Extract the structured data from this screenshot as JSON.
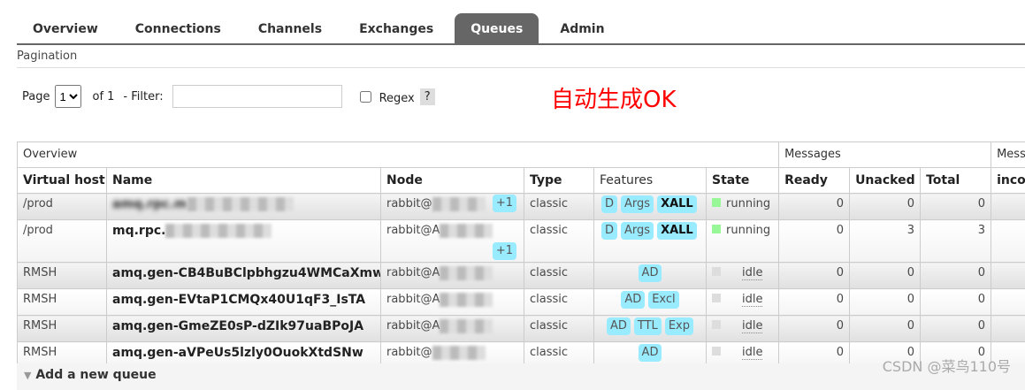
{
  "tabs": [
    "Overview",
    "Connections",
    "Channels",
    "Exchanges",
    "Queues",
    "Admin"
  ],
  "active_tab": "Queues",
  "pagination": {
    "title": "Pagination",
    "page_label": "Page",
    "page_value": "1",
    "of_label": "of 1",
    "filter_label": "- Filter:",
    "filter_value": "",
    "regex_label": "Regex",
    "help": "?"
  },
  "note": "自动生成OK",
  "table": {
    "group_overview": "Overview",
    "group_messages": "Messages",
    "group_rates": "Mess",
    "headers": [
      "Virtual host",
      "Name",
      "Node",
      "Type",
      "Features",
      "State",
      "Ready",
      "Unacked",
      "Total",
      "incon"
    ],
    "rows": [
      {
        "vhost": "/prod",
        "name": "amq.rpc.m",
        "name_blurred": true,
        "node": "rabbit@",
        "extra": "+1",
        "type": "classic",
        "features": [
          {
            "t": "D"
          },
          {
            "t": "Args"
          },
          {
            "t": "XALL",
            "b": true
          }
        ],
        "state": "running",
        "ready": "0",
        "unacked": "0",
        "total": "0"
      },
      {
        "vhost": "/prod",
        "name": "mq.rpc.",
        "name_blurred": true,
        "node": "rabbit@A",
        "extra": "+1",
        "type": "classic",
        "features": [
          {
            "t": "D"
          },
          {
            "t": "Args"
          },
          {
            "t": "XALL",
            "b": true
          }
        ],
        "state": "running",
        "ready": "0",
        "unacked": "3",
        "total": "3"
      },
      {
        "vhost": "RMSH",
        "name": "amq.gen-CB4BuBClpbhgzu4WMCaXmw",
        "node": "rabbit@A",
        "type": "classic",
        "features": [
          {
            "t": "AD"
          }
        ],
        "state": "idle",
        "ready": "0",
        "unacked": "0",
        "total": "0"
      },
      {
        "vhost": "RMSH",
        "name": "amq.gen-EVtaP1CMQx40U1qF3_IsTA",
        "node": "rabbit@A",
        "type": "classic",
        "features": [
          {
            "t": "AD"
          },
          {
            "t": "Excl"
          }
        ],
        "state": "idle",
        "ready": "0",
        "unacked": "0",
        "total": "0"
      },
      {
        "vhost": "RMSH",
        "name": "amq.gen-GmeZE0sP-dZIk97uaBPoJA",
        "node": "rabbit@A",
        "type": "classic",
        "features": [
          {
            "t": "AD"
          },
          {
            "t": "TTL"
          },
          {
            "t": "Exp"
          }
        ],
        "state": "idle",
        "ready": "0",
        "unacked": "0",
        "total": "0"
      },
      {
        "vhost": "RMSH",
        "name": "amq.gen-aVPeUs5lzly0OuokXtdSNw",
        "node": "rabbit@",
        "type": "classic",
        "features": [
          {
            "t": "AD"
          }
        ],
        "state": "idle",
        "ready": "0",
        "unacked": "0",
        "total": "0"
      }
    ]
  },
  "add_queue": "Add a new queue",
  "watermark": "CSDN @菜鸟110号",
  "colors": {
    "badge": "#99ebff",
    "running": "#98f898",
    "note": "#ff0000"
  }
}
